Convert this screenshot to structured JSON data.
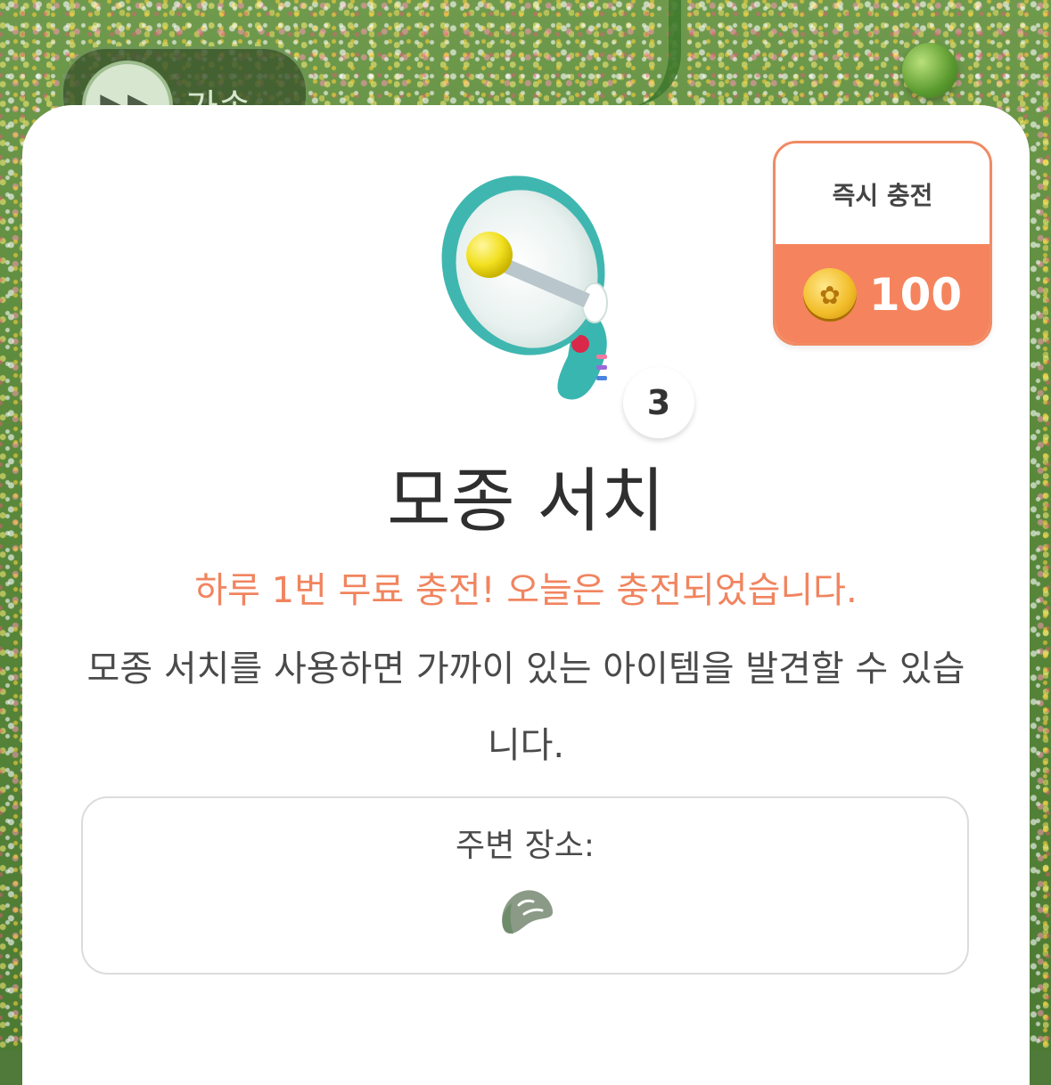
{
  "background": {
    "speed_button": {
      "icon": "fast-forward-icon",
      "label": "가속"
    }
  },
  "modal": {
    "instant_charge": {
      "title": "즉시 충전",
      "coin_icon": "coin-icon",
      "price": "100"
    },
    "item": {
      "icon": "megaphone-icon",
      "count": "3",
      "title": "모종 서치"
    },
    "notice": "하루 1번 무료 충전! 오늘은 충전되었습니다.",
    "description": "모종 서치를 사용하면 가까이 있는 아이템을  발견할 수 있습니다.",
    "nearby": {
      "label": "주변 장소:",
      "place_icon": "seed-icon"
    }
  },
  "colors": {
    "accent": "#f5845e",
    "notice_text": "#f1845f",
    "title_text": "#2f2f2f"
  }
}
